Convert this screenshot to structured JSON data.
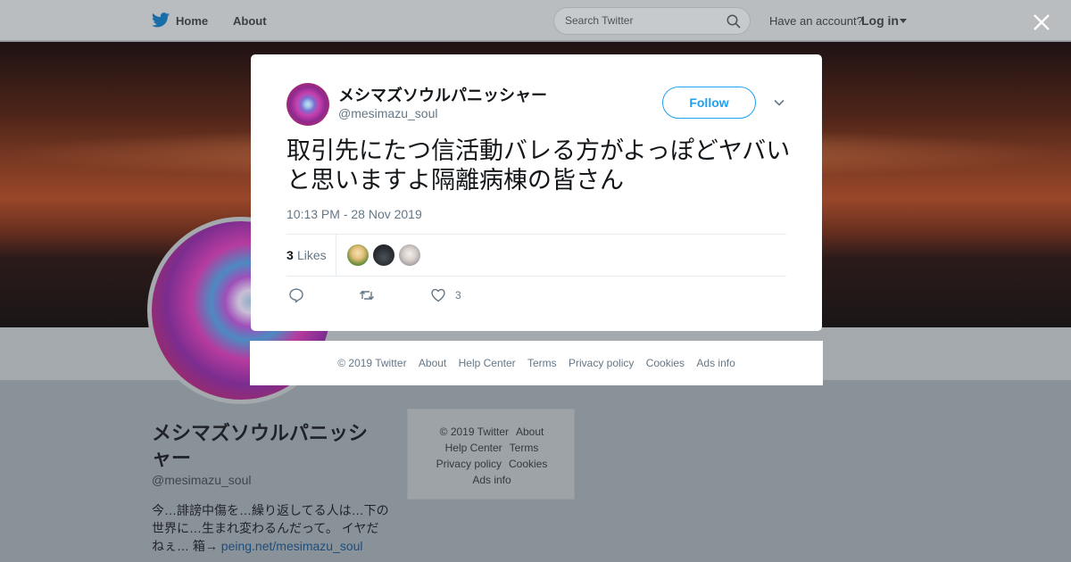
{
  "topbar": {
    "home": "Home",
    "about": "About",
    "search_placeholder": "Search Twitter",
    "have_account": "Have an account?",
    "login": "Log in"
  },
  "profile": {
    "name": "メシマズソウルパニッシャー",
    "handle": "@mesimazu_soul",
    "bio_text": "今…誹謗中傷を…繰り返してる人は…下の世界に…生まれ変わるんだって。 イヤだねぇ… 箱→ ",
    "bio_link": "peing.net/mesimazu_soul"
  },
  "sidebar_footer": {
    "copyright": "© 2019 Twitter",
    "about": "About",
    "help_center": "Help Center",
    "terms": "Terms",
    "privacy": "Privacy policy",
    "cookies": "Cookies",
    "ads_info": "Ads info"
  },
  "tweet": {
    "author_name": "メシマズソウルパニッシャー",
    "author_handle": "@mesimazu_soul",
    "follow_label": "Follow",
    "text": "取引先にたつ信活動バレる方がよっぽどヤバいと思いますよ隔離病棟の皆さん",
    "timestamp": "10:13 PM - 28 Nov 2019",
    "likes_count": "3",
    "likes_label": "Likes",
    "like_action_count": "3"
  },
  "modal_footer": {
    "copyright": "© 2019 Twitter",
    "about": "About",
    "help_center": "Help Center",
    "terms": "Terms",
    "privacy": "Privacy policy",
    "cookies": "Cookies",
    "ads_info": "Ads info"
  },
  "colors": {
    "accent": "#1da1f2",
    "text_primary": "#14171a",
    "text_secondary": "#657786",
    "overlay": "#8a9299"
  },
  "icons": {
    "brand": "twitter-bird-icon",
    "search": "search-icon",
    "close": "close-icon",
    "more": "chevron-down-icon",
    "reply": "reply-icon",
    "retweet": "retweet-icon",
    "like": "heart-icon"
  }
}
